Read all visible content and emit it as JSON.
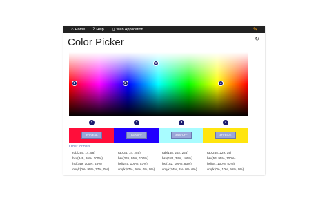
{
  "nav": {
    "home": "Home",
    "help": "Help",
    "web": "Web Application"
  },
  "page": {
    "title": "Color Picker"
  },
  "markers": [
    "1",
    "2",
    "3",
    "4"
  ],
  "swatches": [
    {
      "num": "1",
      "hex": "#FF0E3A",
      "color": "#ff0e3a"
    },
    {
      "num": "2",
      "hex": "#2200FF",
      "color": "#2200ff"
    },
    {
      "num": "3",
      "hex": "#A8FCFF",
      "color": "#a8fcff"
    },
    {
      "num": "4",
      "hex": "#FFE50E",
      "color": "#ffe50e"
    }
  ],
  "formats_label": "Other formats",
  "formats": [
    {
      "rgb": "rgb(255, 14, 58)",
      "hsv": "hsv(349, 95%, 100%)",
      "hsl": "hsl(349, 100%, 53%)",
      "cmyk": "cmyk(0%, 95%, 77%, 0%)"
    },
    {
      "rgb": "rgb(34, 14, 255)",
      "hsv": "hsv(245, 95%, 100%)",
      "hsl": "hsl(245, 100%, 53%)",
      "cmyk": "cmyk(87%, 95%, 0%, 0%)"
    },
    {
      "rgb": "rgb(168, 252, 255)",
      "hsv": "hsv(182, 34%, 100%)",
      "hsl": "hsl(182, 100%, 83%)",
      "cmyk": "cmyk(34%, 1%, 0%, 0%)"
    },
    {
      "rgb": "rgb(255, 229, 14)",
      "hsv": "hsv(54, 95%, 100%)",
      "hsl": "hsl(54, 100%, 53%)",
      "cmyk": "cmyk(0%, 10%, 95%, 0%)"
    }
  ]
}
